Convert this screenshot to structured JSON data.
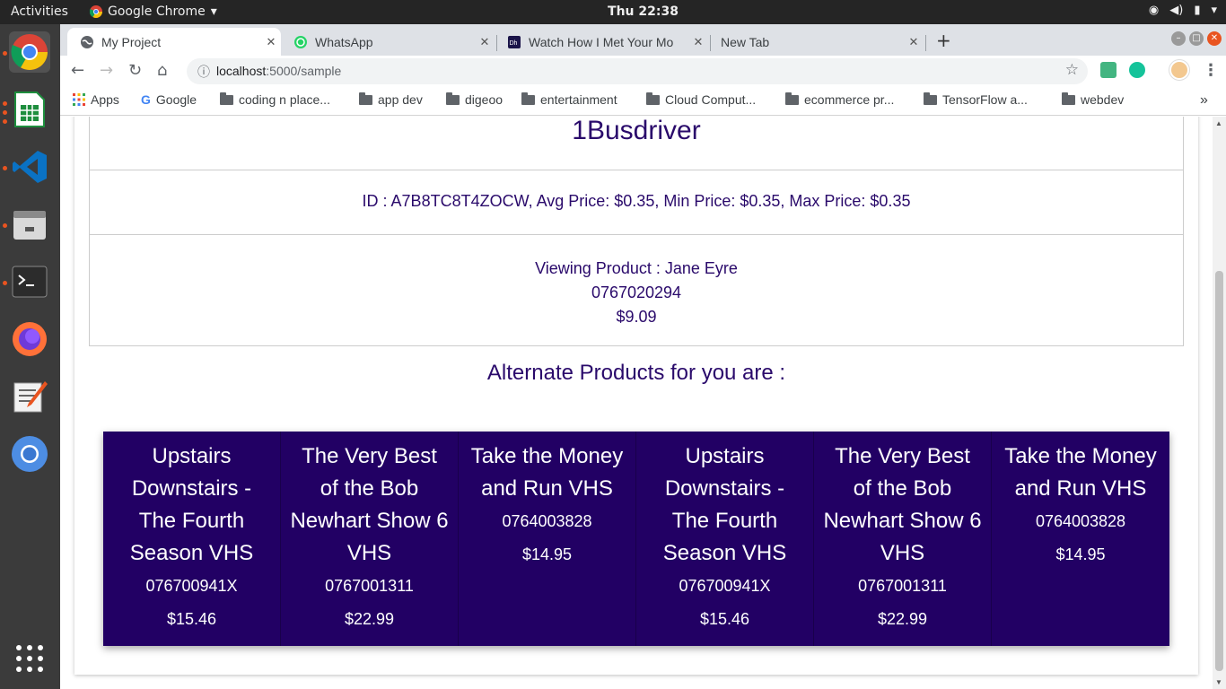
{
  "topbar": {
    "activities": "Activities",
    "app_name": "Google Chrome",
    "clock": "Thu 22:38"
  },
  "dock": {
    "items": [
      "chrome-icon",
      "spreadsheet-icon",
      "vscode-icon",
      "files-icon",
      "terminal-icon",
      "firefox-icon",
      "text-editor-icon",
      "chromium-icon",
      "app-grid-icon"
    ]
  },
  "browser": {
    "tabs": [
      {
        "title": "My Project"
      },
      {
        "title": "WhatsApp"
      },
      {
        "title": "Watch How I Met Your Mo"
      },
      {
        "title": "New Tab"
      }
    ],
    "url_host": "localhost",
    "url_path": ":5000/sample",
    "bookmarks": [
      "Apps",
      "Google",
      "coding n place...",
      "app dev",
      "digeoo",
      "entertainment",
      "Cloud Comput...",
      "ecommerce pr...",
      "TensorFlow a...",
      "webdev"
    ],
    "more_bookmarks": "»"
  },
  "page": {
    "seller_name": "1Busdriver",
    "seller_stats": "ID : A7B8TC8T4ZOCW, Avg Price: $0.35, Min Price: $0.35, Max Price: $0.35",
    "viewing_label": "Viewing Product : Jane Eyre",
    "viewing_asin": "0767020294",
    "viewing_price": "$9.09",
    "alternate_title": "Alternate Products for you are :",
    "alternates": [
      {
        "name": "Upstairs Downstairs - The Fourth Season VHS",
        "asin": "076700941X",
        "price": "$15.46"
      },
      {
        "name": "The Very Best of the Bob Newhart Show 6 VHS",
        "asin": "0767001311",
        "price": "$22.99"
      },
      {
        "name": "Take the Money and Run VHS",
        "asin": "0764003828",
        "price": "$14.95"
      },
      {
        "name": "Upstairs Downstairs - The Fourth Season VHS",
        "asin": "076700941X",
        "price": "$15.46"
      },
      {
        "name": "The Very Best of the Bob Newhart Show 6 VHS",
        "asin": "0767001311",
        "price": "$22.99"
      },
      {
        "name": "Take the Money and Run VHS",
        "asin": "0764003828",
        "price": "$14.95"
      }
    ]
  },
  "colors": {
    "accent": "#2a0a6b",
    "card_bg": "#220064",
    "ubuntu_orange": "#e95420"
  }
}
